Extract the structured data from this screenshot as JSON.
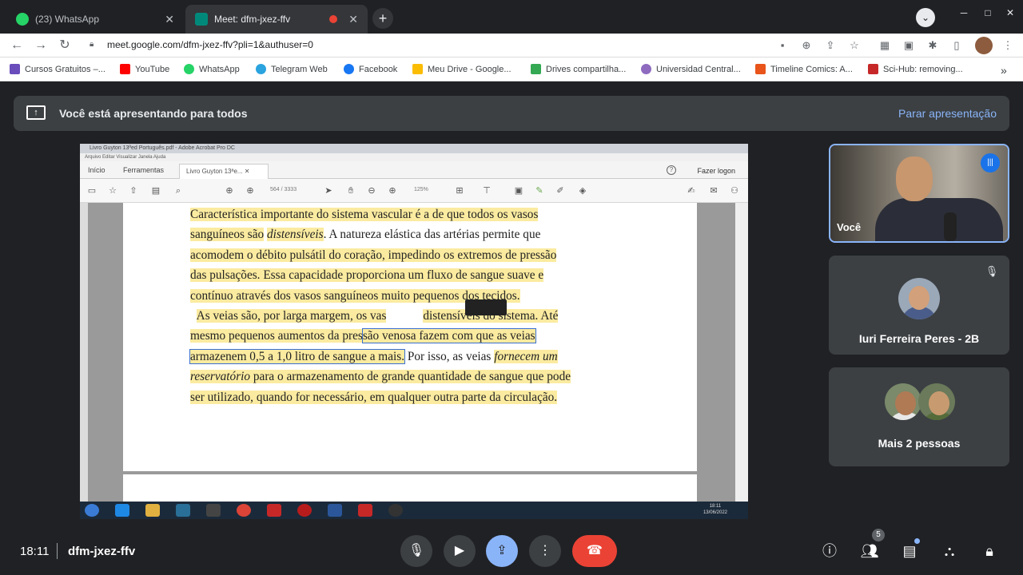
{
  "browser": {
    "tabs": [
      {
        "title": "(23) WhatsApp",
        "active": false
      },
      {
        "title": "Meet: dfm-jxez-ffv",
        "active": true
      }
    ],
    "url": "meet.google.com/dfm-jxez-ffv?pli=1&authuser=0",
    "bookmarks": [
      {
        "label": "Cursos Gratuitos –...",
        "icon_color": "#6a4cbb"
      },
      {
        "label": "YouTube",
        "icon_color": "#ff0000"
      },
      {
        "label": "WhatsApp",
        "icon_color": "#25d366"
      },
      {
        "label": "Telegram Web",
        "icon_color": "#2aa3df"
      },
      {
        "label": "Facebook",
        "icon_color": "#1877f2"
      },
      {
        "label": "Meu Drive - Google...",
        "icon_color": "#fbbc04"
      },
      {
        "label": "Drives compartilha...",
        "icon_color": "#34a853"
      },
      {
        "label": "Universidad Central...",
        "icon_color": "#8e6bbf"
      },
      {
        "label": "Timeline Comics: A...",
        "icon_color": "#e8541a"
      },
      {
        "label": "Sci-Hub: removing...",
        "icon_color": "#c62828"
      }
    ]
  },
  "meet": {
    "banner_text": "Você está apresentando para todos",
    "stop_label": "Parar apresentação",
    "time": "18:11",
    "meeting_code": "dfm-jxez-ffv",
    "participants_count": "5",
    "self_label": "Você",
    "participant_name": "Iuri Ferreira Peres - 2B",
    "more_label": "Mais 2 pessoas"
  },
  "acrobat": {
    "window_title": "Livro Guyton 13ªed Português.pdf - Adobe Acrobat Pro DC",
    "menu": "Arquivo   Editar   Visualizar   Janela   Ajuda",
    "tab_home": "Início",
    "tab_tools": "Ferramentas",
    "tab_file": "Livro Guyton 13ªe...",
    "login": "Fazer logon",
    "page_info": "564  /  3333",
    "zoom": "125%",
    "taskbar_time": "18:11",
    "taskbar_date": "13/06/2022"
  },
  "document": {
    "lines": [
      "Característica importante do sistema vascular é a de que todos os vasos",
      "sanguíneos são",
      "distensíveis",
      ". A natureza elástica das artérias permite que",
      "acomodem o débito pulsátil do coração, impedindo os extremos de pressão",
      "das pulsações. Essa capacidade proporciona um fluxo de sangue suave e",
      "contínuo através dos vasos sanguíneos muito pequenos dos tecidos.",
      "As veias são, por larga margem, os vas",
      "distensíveis do sistema. Até",
      "mesmo pequenos aumentos da pres",
      "são venosa fazem com que as veias",
      "armazenem 0,5 a 1,0 litro de sangue a mais.",
      " Por isso, as veias ",
      "fornecem um",
      "reservatório",
      " para o armazenamento de grande quantidade de sangue que pode",
      "ser utilizado, quando for necessário, em qualquer outra parte da circulação."
    ]
  }
}
